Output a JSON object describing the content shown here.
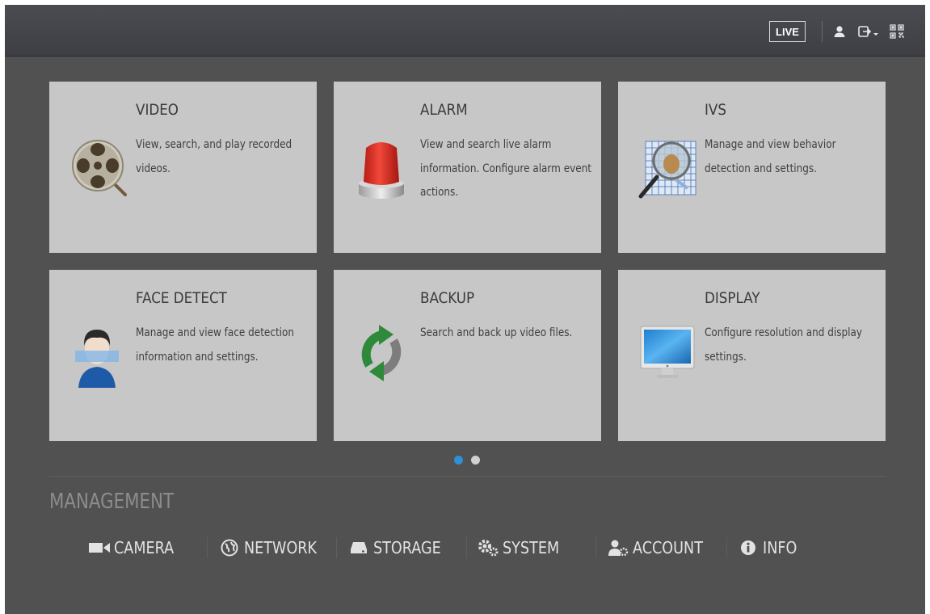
{
  "topbar": {
    "live_label": "LIVE",
    "icons": [
      "user-icon",
      "logout-icon",
      "qr-code-icon"
    ]
  },
  "cards": [
    {
      "title": "VIDEO",
      "desc": "View, search, and play recorded videos.",
      "icon": "film-reel-icon"
    },
    {
      "title": "ALARM",
      "desc": "View and search live alarm information. Configure alarm event actions.",
      "icon": "alarm-light-icon"
    },
    {
      "title": "IVS",
      "desc": "Manage and view behavior detection and settings.",
      "icon": "magnifier-grid-icon"
    },
    {
      "title": "FACE DETECT",
      "desc": "Manage and view face detection information and settings.",
      "icon": "face-scan-icon"
    },
    {
      "title": "BACKUP",
      "desc": "Search and back up video files.",
      "icon": "sync-arrows-icon"
    },
    {
      "title": "DISPLAY",
      "desc": "Configure resolution and display settings.",
      "icon": "monitor-icon"
    }
  ],
  "pager": {
    "count": 2,
    "active": 0
  },
  "management": {
    "title": "MANAGEMENT",
    "items": [
      {
        "label": "CAMERA",
        "icon": "camera-icon"
      },
      {
        "label": "NETWORK",
        "icon": "network-globe-icon"
      },
      {
        "label": "STORAGE",
        "icon": "hard-drive-icon"
      },
      {
        "label": "SYSTEM",
        "icon": "gears-icon"
      },
      {
        "label": "ACCOUNT",
        "icon": "account-icon"
      },
      {
        "label": "INFO",
        "icon": "info-icon"
      }
    ]
  },
  "colors": {
    "accent": "#2f8fd8",
    "card_bg": "#c7c7c7",
    "screen_bg": "#515151"
  }
}
